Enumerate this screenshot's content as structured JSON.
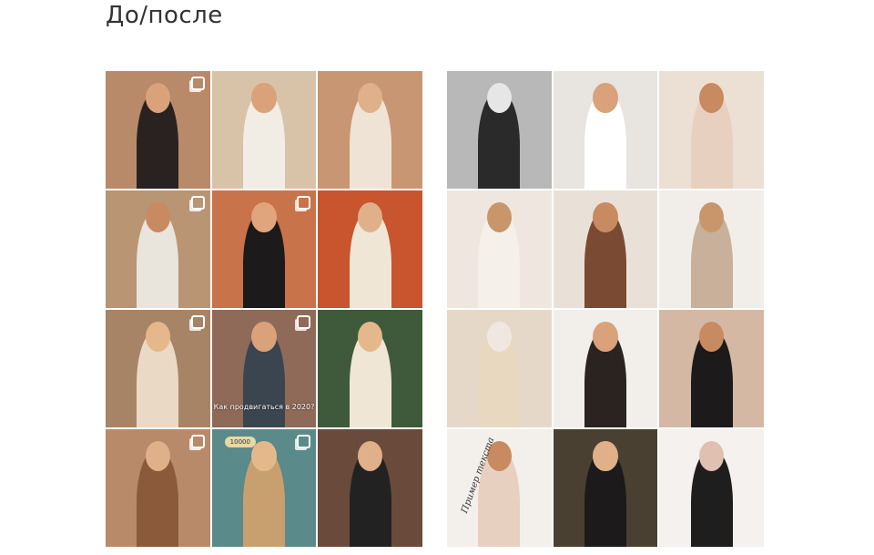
{
  "section": {
    "title": "До/после"
  },
  "before_grid": {
    "tiles": [
      {
        "bg": "#b88a6a",
        "person": "#2a2220",
        "head": "#d9a27a",
        "multi": true
      },
      {
        "bg": "#d8c3a8",
        "person": "#f1ece4",
        "head": "#d9a27a",
        "multi": false
      },
      {
        "bg": "#c89672",
        "person": "#efe3d6",
        "head": "#e0b08a",
        "multi": false
      },
      {
        "bg": "#b99573",
        "person": "#e9e4dc",
        "head": "#c88a60",
        "multi": true
      },
      {
        "bg": "#c8734a",
        "person": "#1c1a1a",
        "head": "#e0a57c",
        "multi": true
      },
      {
        "bg": "#c8552e",
        "person": "#efe6d6",
        "head": "#e0b08a",
        "multi": false
      },
      {
        "bg": "#a88466",
        "person": "#ead9c4",
        "head": "#e5b88c",
        "multi": true
      },
      {
        "bg": "#8f6a58",
        "person": "#3a4550",
        "head": "#d9a27a",
        "multi": true,
        "caption": "Как продвигаться в 2020?"
      },
      {
        "bg": "#3f5a3a",
        "person": "#efe6d6",
        "head": "#e5b88c",
        "multi": false
      },
      {
        "bg": "#b98a6a",
        "person": "#8a5a3a",
        "head": "#e0b08a",
        "multi": true
      },
      {
        "bg": "#5a8a8a",
        "person": "#c8a070",
        "head": "#e5b88c",
        "multi": true,
        "badge": "10000"
      },
      {
        "bg": "#6a4a3a",
        "person": "#222222",
        "head": "#e0b08a",
        "multi": false
      }
    ]
  },
  "after_grid": {
    "tiles": [
      {
        "bg": "#b8b8b8",
        "person": "#2a2a2a",
        "head": "#e6e6e6"
      },
      {
        "bg": "#e8e4e0",
        "person": "#ffffff",
        "head": "#d9a27a"
      },
      {
        "bg": "#ece0d4",
        "person": "#e8d0c0",
        "head": "#c88a60"
      },
      {
        "bg": "#efe7df",
        "person": "#f5f0ea",
        "head": "#c8966a"
      },
      {
        "bg": "#e9e1d8",
        "person": "#7a4a32",
        "head": "#c88a60"
      },
      {
        "bg": "#f1ede9",
        "person": "#c8b09a",
        "head": "#c8966a"
      },
      {
        "bg": "#e6d8c8",
        "person": "#e8d8c0",
        "head": "#f0e8e0"
      },
      {
        "bg": "#f2eee9",
        "person": "#2a2320",
        "head": "#d9a27a"
      },
      {
        "bg": "#d4b8a4",
        "person": "#1c1a1a",
        "head": "#c88a60"
      },
      {
        "bg": "#f3efeb",
        "person": "#e8d0c0",
        "head": "#c88a60",
        "handwriting": "Пример текста"
      },
      {
        "bg": "#4a4032",
        "person": "#1c1a1a",
        "head": "#e0b08a"
      },
      {
        "bg": "#f4f1ee",
        "person": "#1e1e1e",
        "head": "#e0c0b0"
      }
    ]
  }
}
